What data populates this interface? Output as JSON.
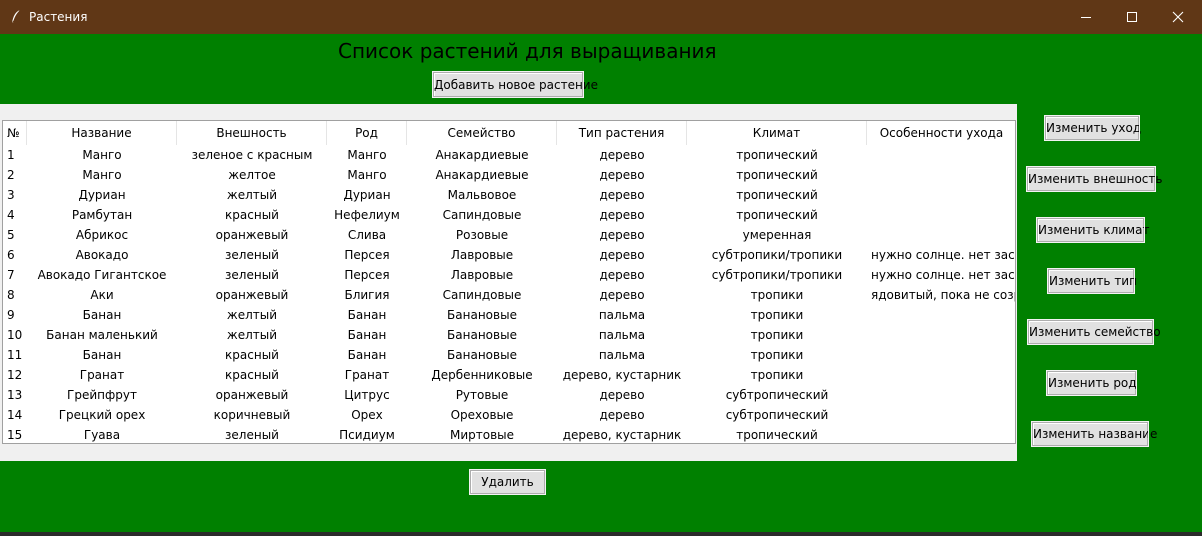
{
  "window": {
    "title": "Растения",
    "icon": "feather-icon"
  },
  "heading": "Список растений для выращивания",
  "buttons": {
    "add": "Добавить новое растение",
    "delete": "Удалить",
    "edit_care": "Изменить уход",
    "edit_appearance": "Изменить внешность",
    "edit_climate": "Изменить климат",
    "edit_type": "Изменить тип",
    "edit_family": "Изменить семейство",
    "edit_genus": "Изменить род",
    "edit_name": "Изменить название"
  },
  "colors": {
    "background": "#008000",
    "titlebar": "#603716"
  },
  "table": {
    "columns": [
      "№",
      "Название",
      "Внешность",
      "Род",
      "Семейство",
      "Тип растения",
      "Климат",
      "Особенности ухода"
    ],
    "rows": [
      [
        "1",
        "Манго",
        "зеленое с красным",
        "Манго",
        "Анакардиевые",
        "дерево",
        "тропический",
        ""
      ],
      [
        "2",
        "Манго",
        "желтое",
        "Манго",
        "Анакардиевые",
        "дерево",
        "тропический",
        ""
      ],
      [
        "3",
        "Дуриан",
        "желтый",
        "Дуриан",
        "Мальвовое",
        "дерево",
        "тропический",
        ""
      ],
      [
        "4",
        "Рамбутан",
        "красный",
        "Нефелиум",
        "Сапиндовые",
        "дерево",
        "тропический",
        ""
      ],
      [
        "5",
        "Абрикос",
        "оранжевый",
        "Слива",
        "Розовые",
        "дерево",
        "умеренная",
        ""
      ],
      [
        "6",
        "Авокадо",
        "зеленый",
        "Персея",
        "Лавровые",
        "дерево",
        "субтропики/тропики",
        "нужно солнце. нет засухе,"
      ],
      [
        "7",
        "Авокадо Гигантское",
        "зеленый",
        "Персея",
        "Лавровые",
        "дерево",
        "субтропики/тропики",
        "нужно солнце. нет засухе,"
      ],
      [
        "8",
        "Аки",
        "оранжевый",
        "Блигия",
        "Сапиндовые",
        "дерево",
        "тропики",
        "ядовитый, пока не созрел"
      ],
      [
        "9",
        "Банан",
        "желтый",
        "Банан",
        "Банановые",
        "пальма",
        "тропики",
        ""
      ],
      [
        "10",
        "Банан маленький",
        "желтый",
        "Банан",
        "Банановые",
        "пальма",
        "тропики",
        ""
      ],
      [
        "11",
        "Банан",
        "красный",
        "Банан",
        "Банановые",
        "пальма",
        "тропики",
        ""
      ],
      [
        "12",
        "Гранат",
        "красный",
        "Гранат",
        "Дербенниковые",
        "дерево, кустарник",
        "тропики",
        ""
      ],
      [
        "13",
        "Грейпфрут",
        "оранжевый",
        "Цитрус",
        "Рутовые",
        "дерево",
        "субтропический",
        ""
      ],
      [
        "14",
        "Грецкий орех",
        "коричневый",
        "Орех",
        "Ореховые",
        "дерево",
        "субтропический",
        ""
      ],
      [
        "15",
        "Гуава",
        "зеленый",
        "Псидиум",
        "Миртовые",
        "дерево, кустарник",
        "тропический",
        ""
      ]
    ]
  }
}
